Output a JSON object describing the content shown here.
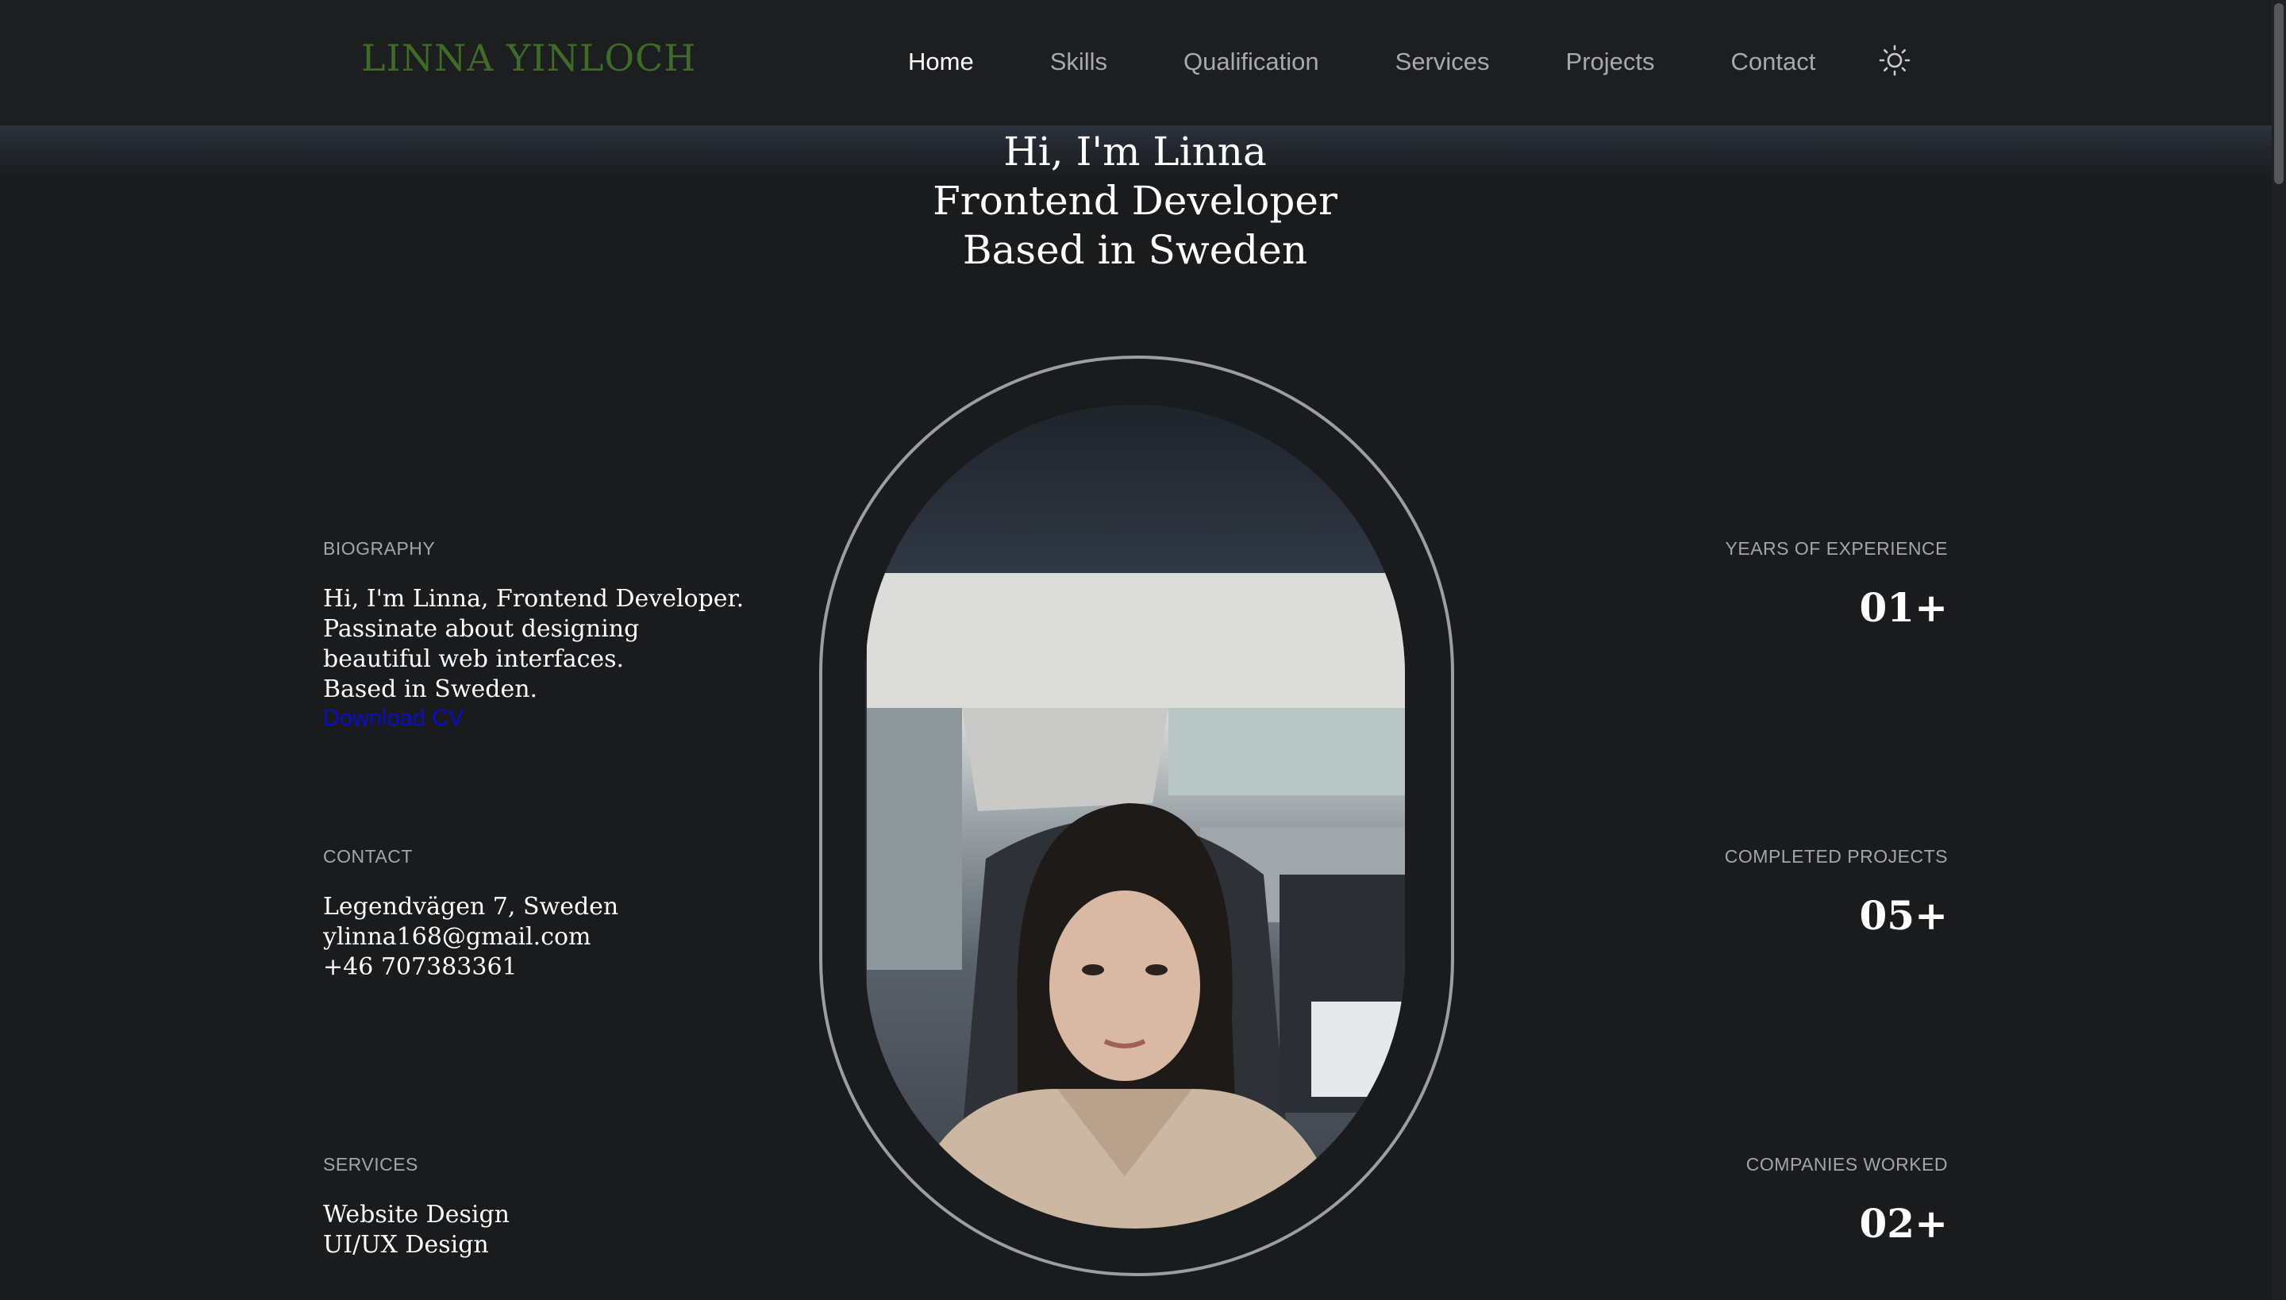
{
  "header": {
    "logo": "LINNA YINLOCH",
    "nav": [
      {
        "label": "Home",
        "active": true
      },
      {
        "label": "Skills",
        "active": false
      },
      {
        "label": "Qualification",
        "active": false
      },
      {
        "label": "Services",
        "active": false
      },
      {
        "label": "Projects",
        "active": false
      },
      {
        "label": "Contact",
        "active": false
      }
    ],
    "theme_icon": "sun-icon"
  },
  "hero": {
    "line1": "Hi, I'm Linna",
    "line2": "Frontend Developer",
    "line3": "Based in Sweden"
  },
  "biography": {
    "label": "BIOGRAPHY",
    "lines": [
      "Hi, I'm Linna, Frontend Developer.",
      "Passinate about designing",
      "beautiful web interfaces.",
      "Based in Sweden."
    ],
    "cv_link": "Download CV"
  },
  "contact": {
    "label": "CONTACT",
    "address": "Legendvägen 7, Sweden",
    "email": "ylinna168@gmail.com",
    "phone": "+46 707383361"
  },
  "services": {
    "label": "SERVICES",
    "items": [
      "Website Design",
      "UI/UX Design"
    ]
  },
  "stats": [
    {
      "label": "YEARS OF EXPERIENCE",
      "value": "01+"
    },
    {
      "label": "COMPLETED PROJECTS",
      "value": "05+"
    },
    {
      "label": "COMPANIES WORKED",
      "value": "02+"
    }
  ],
  "colors": {
    "background": "#1a1b1d",
    "header": "#1d1e20",
    "logo": "#3e6b26",
    "nav_inactive": "#a7a9ad",
    "link": "#0b0bd6"
  }
}
